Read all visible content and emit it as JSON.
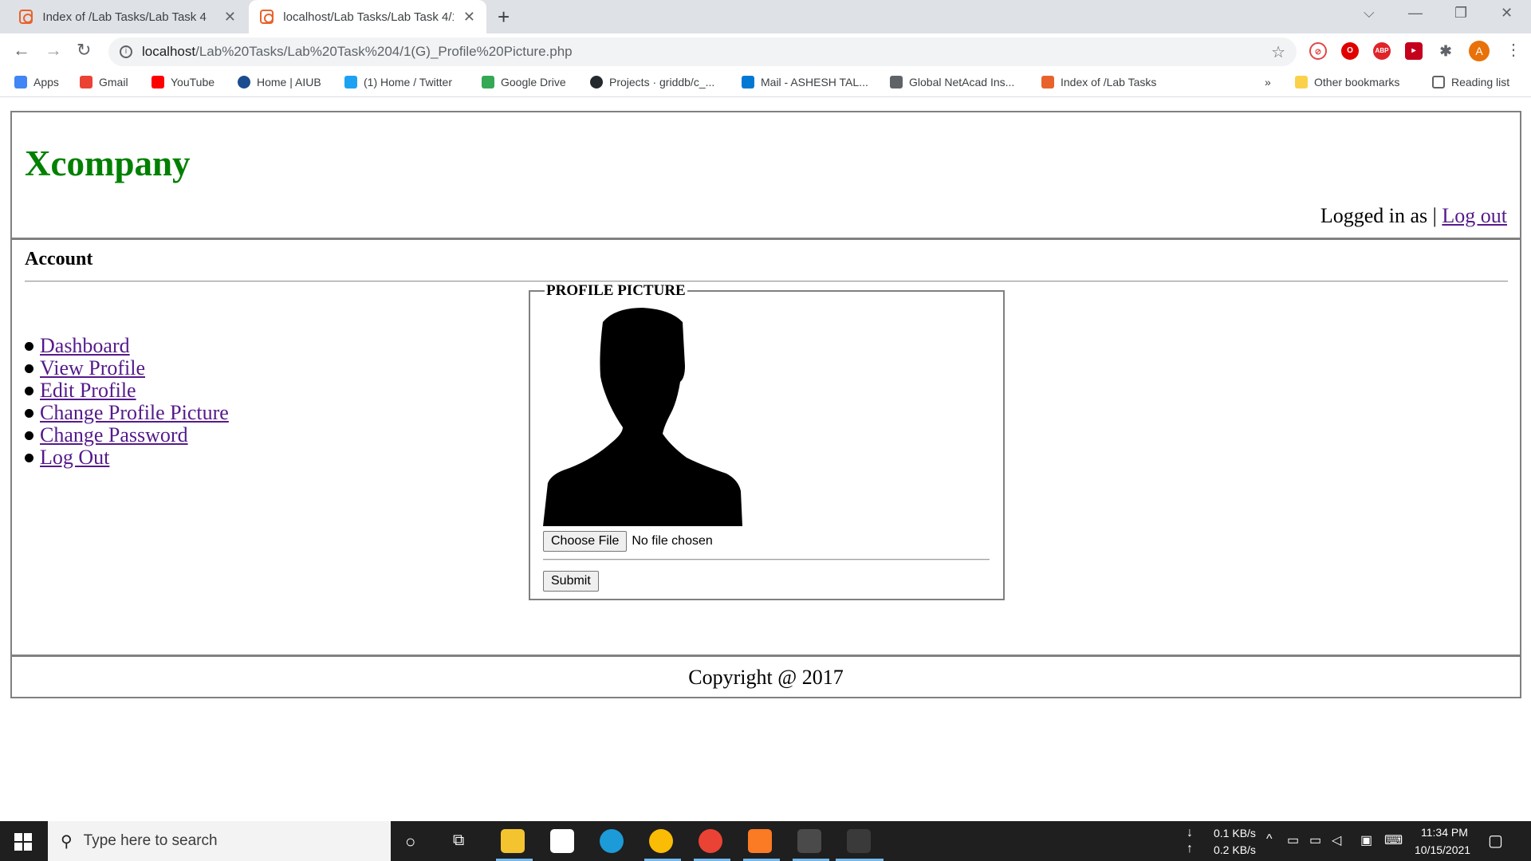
{
  "browser": {
    "tabs": [
      {
        "title": "Index of /Lab Tasks/Lab Task 4",
        "active": false
      },
      {
        "title": "localhost/Lab Tasks/Lab Task 4/1(",
        "active": true
      }
    ],
    "url_host": "localhost",
    "url_path": "/Lab%20Tasks/Lab%20Task%204/1(G)_Profile%20Picture.php",
    "profile_initial": "A",
    "bookmarks": [
      {
        "label": "Apps",
        "icon": "apps-grid-icon",
        "color": "#4285f4"
      },
      {
        "label": "Gmail",
        "icon": "gmail-icon",
        "color": "#ea4335"
      },
      {
        "label": "YouTube",
        "icon": "youtube-icon",
        "color": "#ff0000"
      },
      {
        "label": "Home | AIUB",
        "icon": "aiub-icon",
        "color": "#1a4d8f"
      },
      {
        "label": "(1) Home / Twitter",
        "icon": "twitter-icon",
        "color": "#1da1f2"
      },
      {
        "label": "Google Drive",
        "icon": "google-drive-icon",
        "color": "#34a853"
      },
      {
        "label": "Projects · griddb/c_...",
        "icon": "github-icon",
        "color": "#24292e"
      },
      {
        "label": "Mail - ASHESH TAL...",
        "icon": "outlook-icon",
        "color": "#0078d4"
      },
      {
        "label": "Global NetAcad Ins...",
        "icon": "cisco-icon",
        "color": "#5f6368"
      },
      {
        "label": "Index of /Lab Tasks",
        "icon": "xampp-icon",
        "color": "#e8632b"
      }
    ],
    "overflow_label": "»",
    "other_bookmarks": "Other bookmarks",
    "reading_list": "Reading list"
  },
  "page": {
    "brand": "Xcompany",
    "logged_in_text": "Logged in as |",
    "logout_link": "Log out",
    "section_title": "Account",
    "menu": [
      "Dashboard",
      "View Profile",
      "Edit Profile",
      "Change Profile Picture",
      "Change Password",
      "Log Out"
    ],
    "fieldset_legend": "PROFILE PICTURE",
    "choose_file_label": "Choose File",
    "no_file_text": "No file chosen",
    "submit_label": "Submit",
    "footer": "Copyright @ 2017",
    "colors": {
      "brand": "#008000",
      "link": "#551a8b",
      "border": "#808080"
    }
  },
  "taskbar": {
    "search_placeholder": "Type here to search",
    "net_down": "0.1 KB/s",
    "net_up": "0.2 KB/s",
    "time": "11:34 PM",
    "date": "10/15/2021"
  }
}
